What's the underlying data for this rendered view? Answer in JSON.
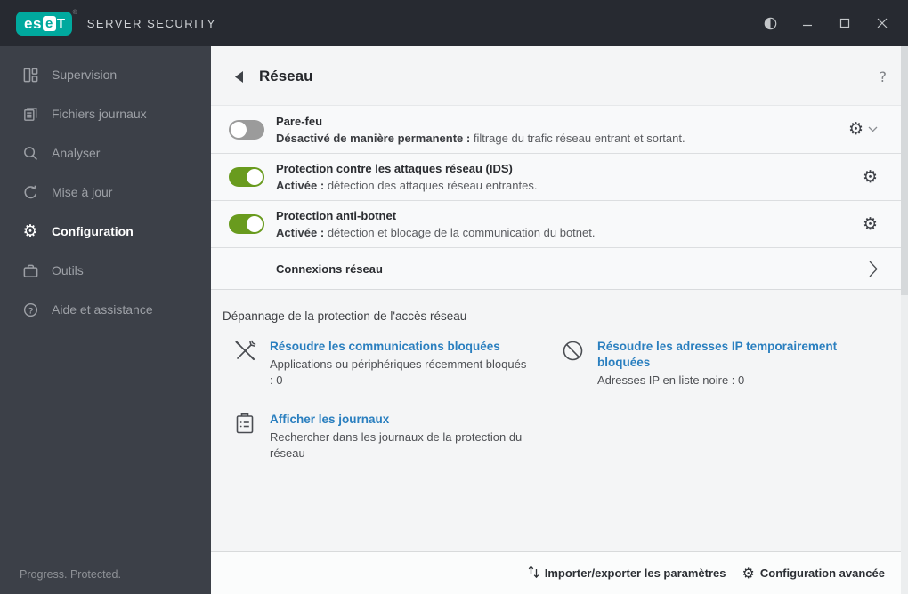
{
  "titlebar": {
    "brand_es": "es",
    "brand_e": "e",
    "brand_t": "T",
    "brand_reg": "®",
    "product": "SERVER SECURITY"
  },
  "sidebar": {
    "items": [
      {
        "label": "Supervision",
        "icon": "dashboard-icon",
        "active": false
      },
      {
        "label": "Fichiers journaux",
        "icon": "log-files-icon",
        "active": false
      },
      {
        "label": "Analyser",
        "icon": "scan-icon",
        "active": false
      },
      {
        "label": "Mise à jour",
        "icon": "update-icon",
        "active": false
      },
      {
        "label": "Configuration",
        "icon": "gear-icon",
        "active": true
      },
      {
        "label": "Outils",
        "icon": "tools-case-icon",
        "active": false
      },
      {
        "label": "Aide et assistance",
        "icon": "help-circle-icon",
        "active": false
      }
    ],
    "tagline": "Progress. Protected."
  },
  "page": {
    "title": "Réseau"
  },
  "icons": {
    "gear": "⚙",
    "help": "?"
  },
  "rows": [
    {
      "title": "Pare-feu",
      "toggle": "off",
      "status_bold": "Désactivé de manière permanente :",
      "status_rest": "filtrage du trafic réseau entrant et sortant."
    },
    {
      "title": "Protection contre les attaques réseau (IDS)",
      "toggle": "on",
      "status_bold": "Activée :",
      "status_rest": "détection des attaques réseau entrantes."
    },
    {
      "title": "Protection anti-botnet",
      "toggle": "on",
      "status_bold": "Activée :",
      "status_rest": "détection et blocage de la communication du botnet."
    },
    {
      "title": "Connexions réseau"
    }
  ],
  "troubleshooting": {
    "heading": "Dépannage de la protection de l'accès réseau",
    "cards": [
      {
        "icon": "repair-tools-icon",
        "link": "Résoudre les communications bloquées",
        "desc": "Applications ou périphériques récemment bloqués : 0"
      },
      {
        "icon": "blocked-circle-icon",
        "link": "Résoudre les adresses IP temporairement bloquées",
        "desc": "Adresses IP en liste noire : 0"
      },
      {
        "icon": "clipboard-logs-icon",
        "link": "Afficher les journaux",
        "desc": "Rechercher dans les journaux de la protection du réseau"
      }
    ]
  },
  "footer": {
    "import_export": "Importer/exporter les paramètres",
    "advanced": "Configuration avancée"
  },
  "colors": {
    "titlebar_bg": "#272a31",
    "sidebar_bg": "#3c4048",
    "content_bg": "#f4f5f6",
    "eset_teal": "#00a99e",
    "toggle_on_green": "#699b1e",
    "toggle_off_gray": "#9b9b9b",
    "link_blue": "#2a7fbf"
  }
}
